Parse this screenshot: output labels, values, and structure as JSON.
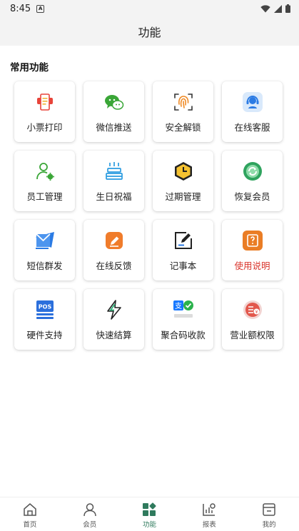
{
  "status_bar": {
    "time": "8:45",
    "notif_letter": "A"
  },
  "app_bar": {
    "title": "功能"
  },
  "section": {
    "title": "常用功能"
  },
  "functions": [
    {
      "label": "小票打印",
      "icon": "receipt-printer-icon"
    },
    {
      "label": "微信推送",
      "icon": "wechat-icon"
    },
    {
      "label": "安全解锁",
      "icon": "fingerprint-icon"
    },
    {
      "label": "在线客服",
      "icon": "customer-service-icon"
    },
    {
      "label": "员工管理",
      "icon": "staff-icon"
    },
    {
      "label": "生日祝福",
      "icon": "birthday-cake-icon"
    },
    {
      "label": "过期管理",
      "icon": "expiry-clock-icon"
    },
    {
      "label": "恢复会员",
      "icon": "restore-member-icon"
    },
    {
      "label": "短信群发",
      "icon": "sms-envelope-icon"
    },
    {
      "label": "在线反馈",
      "icon": "feedback-edit-icon"
    },
    {
      "label": "记事本",
      "icon": "notepad-icon"
    },
    {
      "label": "使用说明",
      "icon": "help-manual-icon"
    },
    {
      "label": "硬件支持",
      "icon": "pos-hardware-icon"
    },
    {
      "label": "快速结算",
      "icon": "lightning-icon"
    },
    {
      "label": "聚合码收款",
      "icon": "aggregate-payment-icon"
    },
    {
      "label": "营业额权限",
      "icon": "revenue-permission-icon"
    }
  ],
  "bottom_nav": {
    "home": "首页",
    "member": "会员",
    "function": "功能",
    "report": "报表",
    "mine": "我的"
  },
  "colors": {
    "accent_green": "#2f7a5d",
    "alert_red": "#d9342b"
  }
}
